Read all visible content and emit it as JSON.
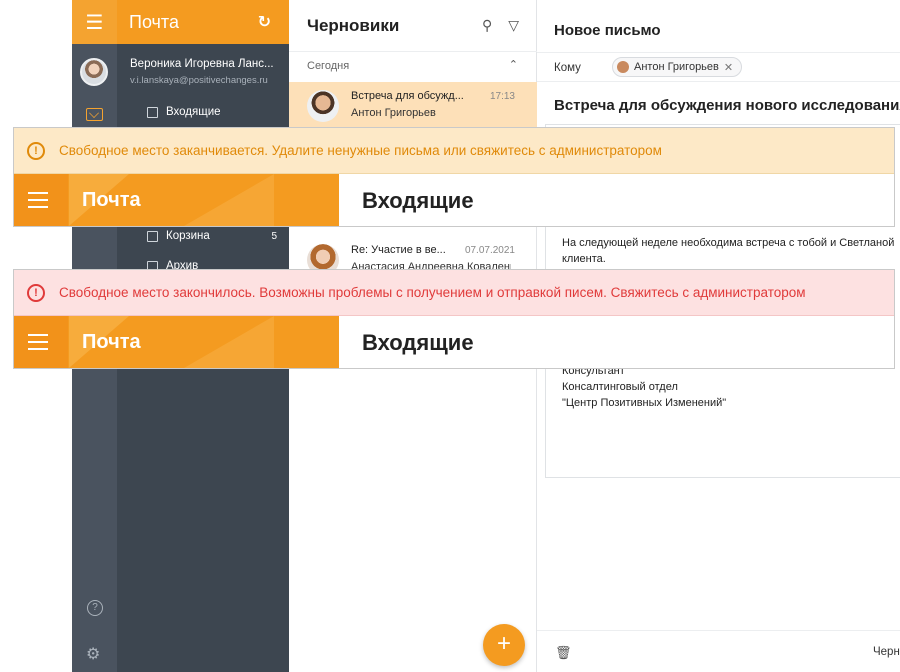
{
  "app": {
    "rail_menu_icon": "menu-icon",
    "title": "Почта",
    "refresh_icon": "refresh-icon"
  },
  "user": {
    "name": "Вероника Игоревна Ланс...",
    "email": "v.i.lanskaya@positivechanges.ru"
  },
  "folders": [
    {
      "label": "Входящие",
      "icon": "inbox-icon",
      "count": ""
    },
    {
      "label": "Корзина",
      "icon": "trash-icon",
      "count": "5"
    },
    {
      "label": "Архив",
      "icon": "archive-icon",
      "count": ""
    }
  ],
  "list": {
    "title": "Черновики",
    "group_today": "Сегодня",
    "messages": [
      {
        "subject": "Встреча для обсужд...",
        "from": "Антон Григорьев",
        "date": "17:13",
        "selected": true
      },
      {
        "subject": "Re: Участие в ве...",
        "from": "Анастасия Андреевна Коваленко",
        "date": "07.07.2021",
        "selected": false
      }
    ],
    "fab_label": "+"
  },
  "compose": {
    "title": "Новое письмо",
    "to_label": "Кому",
    "recipient": "Антон Григорьев",
    "subject": "Встреча для обсуждения нового исследования",
    "body_lines": [
      "На следующей неделе необходима встреча с тобой и Светланой",
      "клиента.",
      "Консультант",
      "Консалтинговый отдел",
      "\"Центр Позитивных Изменений\""
    ],
    "drafts_button": "Черн"
  },
  "banners": [
    {
      "type": "warning",
      "message": "Свободное место заканчивается. Удалите ненужные письма или свяжитесь с администратором",
      "brand": "Почта",
      "section": "Входящие",
      "color": "#e08a0a",
      "background": "#fde9c7"
    },
    {
      "type": "error",
      "message": "Свободное место закончилось. Возможны проблемы с получением и отправкой писем. Свяжитесь с администратором",
      "brand": "Почта",
      "section": "Входящие",
      "color": "#e03a3a",
      "background": "#fde1e1"
    }
  ],
  "colors": {
    "accent": "#f49b20",
    "sidebar": "#3d4650",
    "rail": "#4a535f",
    "selected_row": "#fde0b8"
  }
}
